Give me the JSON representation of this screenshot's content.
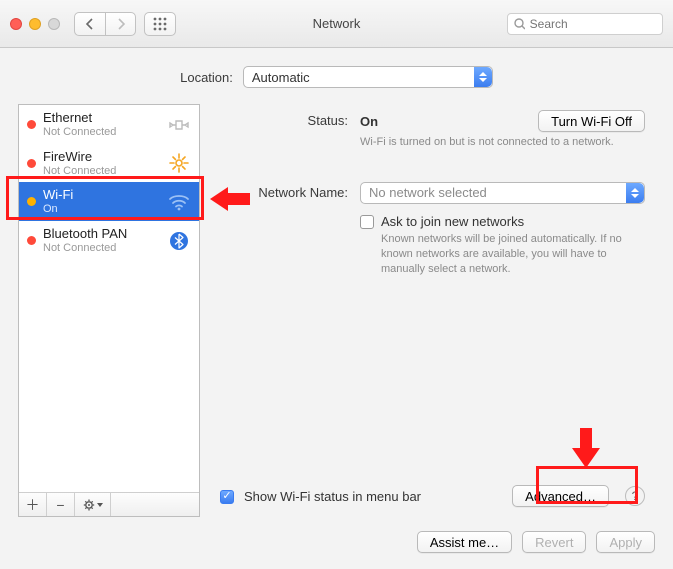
{
  "window": {
    "title": "Network",
    "search_placeholder": "Search"
  },
  "location": {
    "label": "Location:",
    "value": "Automatic"
  },
  "services": [
    {
      "name": "Ethernet",
      "status": "Not Connected",
      "dot": "red",
      "icon": "ethernet"
    },
    {
      "name": "FireWire",
      "status": "Not Connected",
      "dot": "red",
      "icon": "firewire"
    },
    {
      "name": "Wi-Fi",
      "status": "On",
      "dot": "orange",
      "icon": "wifi",
      "selected": true
    },
    {
      "name": "Bluetooth PAN",
      "status": "Not Connected",
      "dot": "red",
      "icon": "bluetooth"
    }
  ],
  "sidebar_footer": {
    "add": "+",
    "remove": "−",
    "action": "✻▾"
  },
  "detail": {
    "status_label": "Status:",
    "status_value": "On",
    "toggle_button": "Turn Wi-Fi Off",
    "status_hint": "Wi-Fi is turned on but is not connected to a network.",
    "network_name_label": "Network Name:",
    "network_name_value": "No network selected",
    "ask_join_label": "Ask to join new networks",
    "ask_join_checked": false,
    "ask_join_hint": "Known networks will be joined automatically. If no known networks are available, you will have to manually select a network.",
    "show_menubar_label": "Show Wi-Fi status in menu bar",
    "show_menubar_checked": true,
    "advanced_button": "Advanced…"
  },
  "buttons": {
    "assist": "Assist me…",
    "revert": "Revert",
    "apply": "Apply"
  }
}
